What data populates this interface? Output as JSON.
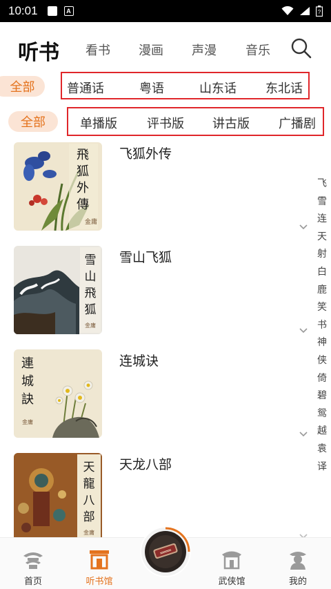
{
  "status_bar": {
    "time": "10:01",
    "badge_letter": "A"
  },
  "header": {
    "title": "听书",
    "tabs": [
      {
        "label": "看书"
      },
      {
        "label": "漫画"
      },
      {
        "label": "声漫"
      },
      {
        "label": "音乐"
      }
    ]
  },
  "language_filter": {
    "all_label": "全部",
    "options": [
      "普通话",
      "粤语",
      "山东话",
      "东北话"
    ]
  },
  "version_filter": {
    "all_label": "全部",
    "options": [
      "单播版",
      "评书版",
      "讲古版",
      "广播剧"
    ]
  },
  "books": [
    {
      "title": "飞狐外传",
      "cover_text": "飛狐外傳",
      "author_seal": "金庸"
    },
    {
      "title": "雪山飞狐",
      "cover_text": "雪山飛狐",
      "author_seal": "金庸"
    },
    {
      "title": "连城诀",
      "cover_text": "連城訣",
      "author_seal": "金庸"
    },
    {
      "title": "天龙八部",
      "cover_text": "天龍八部",
      "author_seal": "金庸"
    }
  ],
  "side_index": [
    "飞",
    "雪",
    "连",
    "天",
    "射",
    "白",
    "鹿",
    "笑",
    "书",
    "神",
    "侠",
    "倚",
    "碧",
    "鸳",
    "越",
    "袁",
    "译"
  ],
  "bottom_tabs": [
    {
      "label": "首页"
    },
    {
      "label": "听书馆"
    },
    {
      "label": "武侠馆"
    },
    {
      "label": "我的"
    }
  ],
  "colors": {
    "accent": "#e4731e",
    "highlight_box": "#e0262a",
    "pill_bg": "#fbe4d5"
  }
}
